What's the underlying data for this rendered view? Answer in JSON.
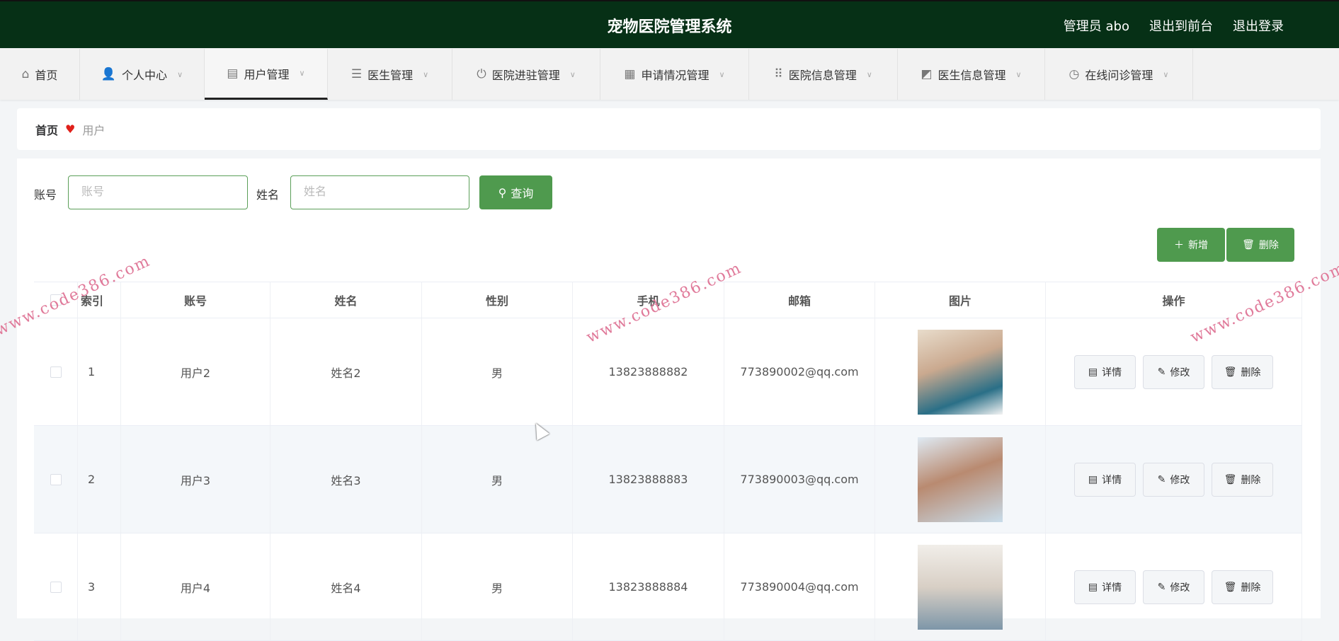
{
  "header": {
    "title": "宠物医院管理系统",
    "user": "管理员 abo",
    "to_front": "退出到前台",
    "logout": "退出登录"
  },
  "nav": [
    {
      "label": "首页",
      "icon": "⌂"
    },
    {
      "label": "个人中心",
      "icon": "👤"
    },
    {
      "label": "用户管理",
      "icon": "▤"
    },
    {
      "label": "医生管理",
      "icon": "☰"
    },
    {
      "label": "医院进驻管理",
      "icon": "⏻"
    },
    {
      "label": "申请情况管理",
      "icon": "▦"
    },
    {
      "label": "医院信息管理",
      "icon": "⠿"
    },
    {
      "label": "医生信息管理",
      "icon": "◩"
    },
    {
      "label": "在线问诊管理",
      "icon": "◷"
    }
  ],
  "breadcrumb": {
    "home": "首页",
    "current": "用户"
  },
  "search": {
    "account_label": "账号",
    "account_placeholder": "账号",
    "name_label": "姓名",
    "name_placeholder": "姓名",
    "query": "查询"
  },
  "toolbar": {
    "add": "新增",
    "delete": "删除"
  },
  "table": {
    "headers": [
      "索引",
      "账号",
      "姓名",
      "性别",
      "手机",
      "邮箱",
      "图片",
      "操作"
    ],
    "rows": [
      {
        "index": "1",
        "account": "用户2",
        "name": "姓名2",
        "gender": "男",
        "phone": "13823888882",
        "email": "773890002@qq.com"
      },
      {
        "index": "2",
        "account": "用户3",
        "name": "姓名3",
        "gender": "男",
        "phone": "13823888883",
        "email": "773890003@qq.com"
      },
      {
        "index": "3",
        "account": "用户4",
        "name": "姓名4",
        "gender": "男",
        "phone": "13823888884",
        "email": "773890004@qq.com"
      }
    ],
    "actions": {
      "detail": "详情",
      "edit": "修改",
      "delete": "删除"
    }
  },
  "watermark": "www.code386.com",
  "colors": {
    "header": "#063016",
    "accent": "#4f9a4e"
  }
}
